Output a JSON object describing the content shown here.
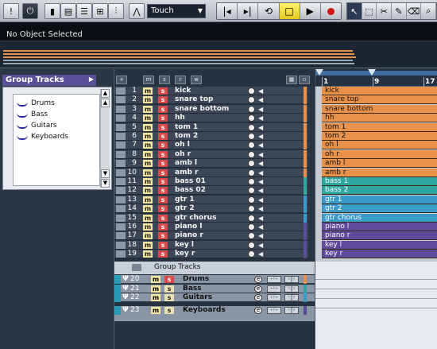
{
  "toolbar": {
    "automation_mode": "Touch",
    "colors": {
      "transport_active": "#f0d830",
      "record": "#d01818"
    }
  },
  "infoline": {
    "text": "No Object Selected"
  },
  "inspector": {
    "title": "Group Tracks",
    "items": [
      "Drums",
      "Bass",
      "Guitars",
      "Keyboards"
    ]
  },
  "tracklist": {
    "header_buttons": [
      "m",
      "s",
      "r",
      "w"
    ],
    "mute_label": "m",
    "solo_label": "s",
    "tracks": [
      {
        "num": "1",
        "name": "kick",
        "color": "#e8914a"
      },
      {
        "num": "2",
        "name": "snare top",
        "color": "#e8914a"
      },
      {
        "num": "3",
        "name": "snare bottom",
        "color": "#e8914a"
      },
      {
        "num": "4",
        "name": "hh",
        "color": "#e8914a"
      },
      {
        "num": "5",
        "name": "tom 1",
        "color": "#e8914a"
      },
      {
        "num": "6",
        "name": "tom 2",
        "color": "#e8914a"
      },
      {
        "num": "7",
        "name": "oh l",
        "color": "#e8914a"
      },
      {
        "num": "8",
        "name": "oh r",
        "color": "#e8914a"
      },
      {
        "num": "9",
        "name": "amb l",
        "color": "#e8914a"
      },
      {
        "num": "10",
        "name": "amb r",
        "color": "#e8914a"
      },
      {
        "num": "11",
        "name": "bass 01",
        "color": "#2fa7a0"
      },
      {
        "num": "12",
        "name": "bass 02",
        "color": "#2fa7a0"
      },
      {
        "num": "13",
        "name": "gtr 1",
        "color": "#3a9bc8"
      },
      {
        "num": "14",
        "name": "gtr 2",
        "color": "#3a9bc8"
      },
      {
        "num": "15",
        "name": "gtr chorus",
        "color": "#3a9bc8"
      },
      {
        "num": "16",
        "name": "piano l",
        "color": "#5c4a9a"
      },
      {
        "num": "17",
        "name": "piano r",
        "color": "#5c4a9a"
      },
      {
        "num": "18",
        "name": "key l",
        "color": "#5c4a9a"
      },
      {
        "num": "19",
        "name": "key r",
        "color": "#5c4a9a"
      }
    ],
    "group_folder": "Group Tracks",
    "group_tracks": [
      {
        "num": "20",
        "name": "Drums",
        "color": "#e8914a",
        "solo_active": true
      },
      {
        "num": "21",
        "name": "Bass",
        "color": "#2fa7a0",
        "solo_active": false
      },
      {
        "num": "22",
        "name": "Guitars",
        "color": "#3a9bc8",
        "solo_active": false
      },
      {
        "num": "23",
        "name": "Keyboards",
        "color": "#5c4a9a",
        "solo_active": false
      }
    ]
  },
  "ruler": {
    "marks": [
      "1",
      "9",
      "17"
    ]
  },
  "events": [
    {
      "name": "kick",
      "color": "#e8914a"
    },
    {
      "name": "snare top",
      "color": "#e8914a"
    },
    {
      "name": "snare bottom",
      "color": "#e8914a"
    },
    {
      "name": "hh",
      "color": "#e8914a"
    },
    {
      "name": "tom 1",
      "color": "#e8914a"
    },
    {
      "name": "tom 2",
      "color": "#e8914a"
    },
    {
      "name": "oh l",
      "color": "#e8914a"
    },
    {
      "name": "oh r",
      "color": "#e8914a"
    },
    {
      "name": "amb l",
      "color": "#e8914a"
    },
    {
      "name": "amb r",
      "color": "#e8914a"
    },
    {
      "name": "bass 1",
      "color": "#2fa7a0"
    },
    {
      "name": "bass 2",
      "color": "#2fa7a0"
    },
    {
      "name": "gtr 1",
      "color": "#3a9bc8"
    },
    {
      "name": "gtr 2",
      "color": "#3a9bc8"
    },
    {
      "name": "gtr chorus",
      "color": "#3a9bc8"
    },
    {
      "name": "piano l",
      "color": "#5c4a9a"
    },
    {
      "name": "piano r",
      "color": "#5c4a9a"
    },
    {
      "name": "key l",
      "color": "#5c4a9a"
    },
    {
      "name": "key r",
      "color": "#5c4a9a"
    }
  ]
}
